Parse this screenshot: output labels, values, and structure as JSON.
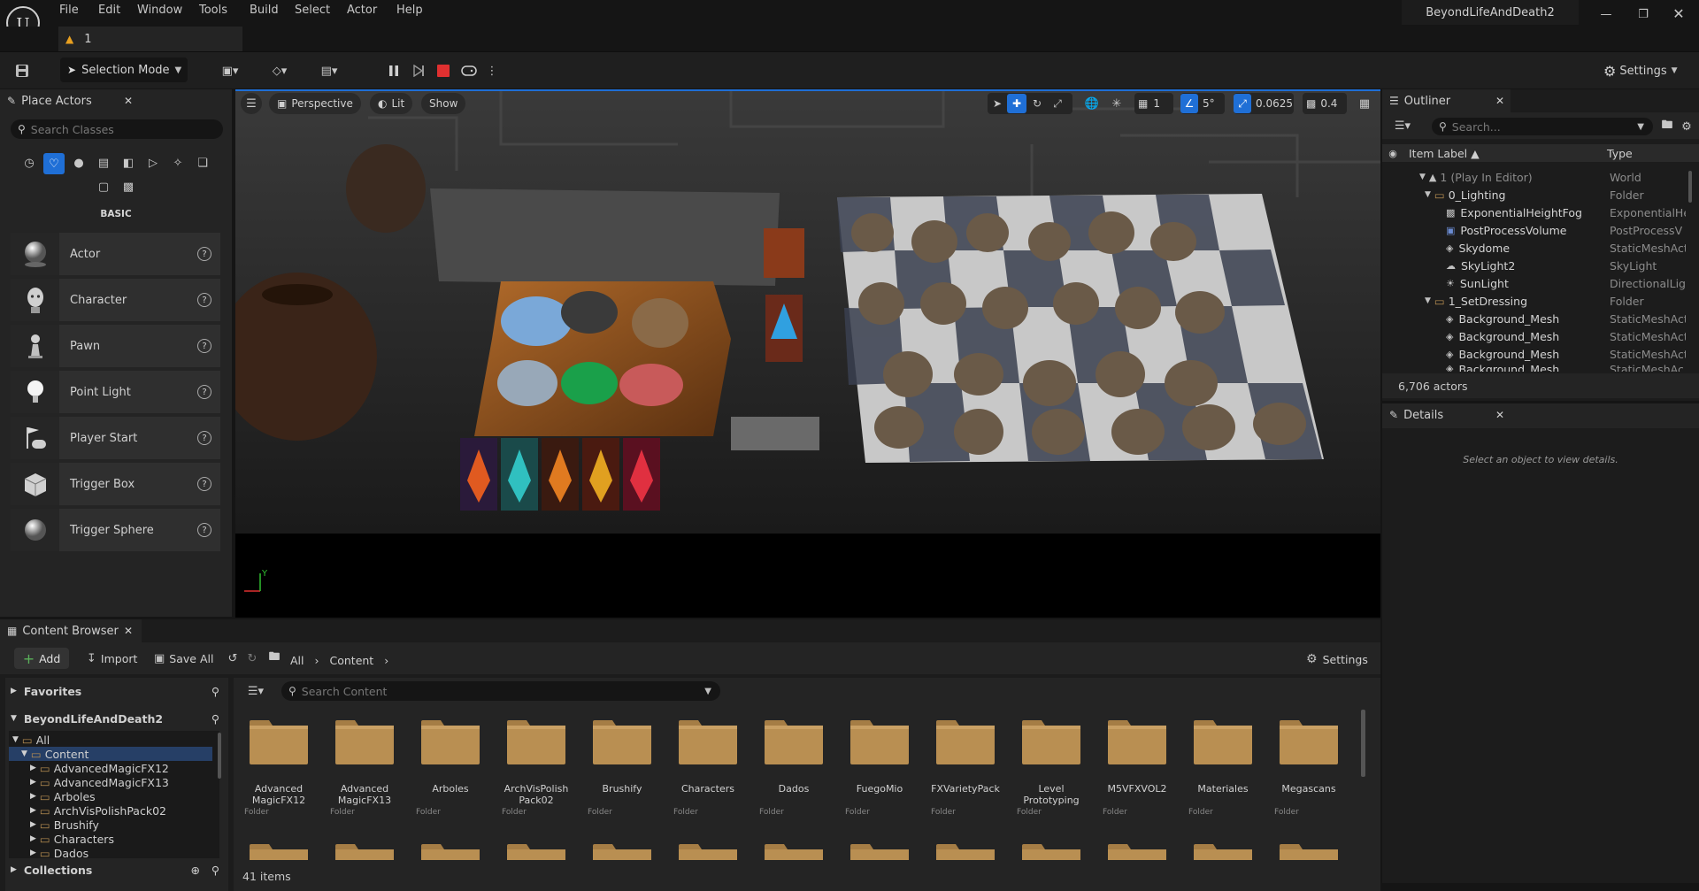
{
  "menu": [
    "File",
    "Edit",
    "Window",
    "Tools",
    "Build",
    "Select",
    "Actor",
    "Help"
  ],
  "project_title": "BeyondLifeAndDeath2",
  "level_tab": {
    "label": "1"
  },
  "toolbar": {
    "selection_mode": "Selection Mode",
    "settings": "Settings"
  },
  "place_actors": {
    "title": "Place Actors",
    "search_placeholder": "Search Classes",
    "category": "BASIC",
    "items": [
      {
        "label": "Actor"
      },
      {
        "label": "Character"
      },
      {
        "label": "Pawn"
      },
      {
        "label": "Point Light"
      },
      {
        "label": "Player Start"
      },
      {
        "label": "Trigger Box"
      },
      {
        "label": "Trigger Sphere"
      }
    ]
  },
  "viewport": {
    "perspective": "Perspective",
    "lit": "Lit",
    "show": "Show",
    "grid_value": "1",
    "rotation_snap": "5°",
    "scale_snap": "0.0625",
    "camera_speed": "0.4",
    "axis_y": "Y"
  },
  "outliner": {
    "title": "Outliner",
    "search_placeholder": "Search...",
    "col_label": "Item Label",
    "col_type": "Type",
    "rows": [
      {
        "label": "1 (Play In Editor)",
        "type": "World"
      },
      {
        "label": "0_Lighting",
        "type": "Folder"
      },
      {
        "label": "ExponentialHeightFog",
        "type": "ExponentialHe"
      },
      {
        "label": "PostProcessVolume",
        "type": "PostProcessV"
      },
      {
        "label": "Skydome",
        "type": "StaticMeshAct"
      },
      {
        "label": "SkyLight2",
        "type": "SkyLight"
      },
      {
        "label": "SunLight",
        "type": "DirectionalLigl"
      },
      {
        "label": "1_SetDressing",
        "type": "Folder"
      },
      {
        "label": "Background_Mesh",
        "type": "StaticMeshAct"
      },
      {
        "label": "Background_Mesh",
        "type": "StaticMeshAct"
      },
      {
        "label": "Background_Mesh",
        "type": "StaticMeshAct"
      },
      {
        "label": "Background_Mesh",
        "type": "StaticMeshAct"
      }
    ],
    "actor_count": "6,706 actors"
  },
  "details": {
    "title": "Details",
    "empty_message": "Select an object to view details."
  },
  "content_browser": {
    "title": "Content Browser",
    "add": "Add",
    "import": "Import",
    "save_all": "Save All",
    "breadcrumb": [
      "All",
      "Content"
    ],
    "settings": "Settings",
    "search_placeholder": "Search Content",
    "favorites": "Favorites",
    "project": "BeyondLifeAndDeath2",
    "tree": [
      "All",
      "Content",
      "AdvancedMagicFX12",
      "AdvancedMagicFX13",
      "Arboles",
      "ArchVisPolishPack02",
      "Brushify",
      "Characters",
      "Dados"
    ],
    "collections": "Collections",
    "folders": [
      {
        "name": "Advanced MagicFX12",
        "type": "Folder"
      },
      {
        "name": "Advanced MagicFX13",
        "type": "Folder"
      },
      {
        "name": "Arboles",
        "type": "Folder"
      },
      {
        "name": "ArchVisPolish Pack02",
        "type": "Folder"
      },
      {
        "name": "Brushify",
        "type": "Folder"
      },
      {
        "name": "Characters",
        "type": "Folder"
      },
      {
        "name": "Dados",
        "type": "Folder"
      },
      {
        "name": "FuegoMio",
        "type": "Folder"
      },
      {
        "name": "FXVarietyPack",
        "type": "Folder"
      },
      {
        "name": "Level Prototyping",
        "type": "Folder"
      },
      {
        "name": "M5VFXVOL2",
        "type": "Folder"
      },
      {
        "name": "Materiales",
        "type": "Folder"
      },
      {
        "name": "Megascans",
        "type": "Folder"
      }
    ],
    "item_count": "41 items"
  },
  "colors": {
    "accent": "#1f6fd6",
    "folder": "#b98f52",
    "selection": "#263f66"
  }
}
